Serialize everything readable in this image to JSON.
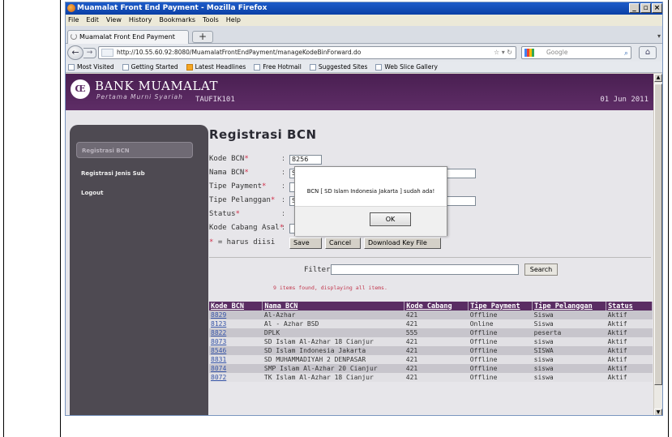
{
  "browser": {
    "window_title": "Muamalat Front End Payment - Mozilla Firefox",
    "menu": [
      "File",
      "Edit",
      "View",
      "History",
      "Bookmarks",
      "Tools",
      "Help"
    ],
    "tab_label": "Muamalat Front End Payment",
    "url": "http://10.55.60.92:8080/MuamalatFrontEndPayment/manageKodeBinForward.do",
    "search_placeholder": "Google",
    "bookmarks": [
      "Most Visited",
      "Getting Started",
      "Latest Headlines",
      "Free Hotmail",
      "Suggested Sites",
      "Web Slice Gallery"
    ]
  },
  "page": {
    "header": {
      "bank_name": "BANK MUAMALAT",
      "tagline": "Pertama Murni Syariah",
      "user": "TAUFIK101",
      "date": "01 Jun 2011"
    },
    "sidebar": [
      "Registrasi BCN",
      "Registrasi Jenis Sub",
      "Logout"
    ],
    "form": {
      "title": "Registrasi BCN",
      "fields": [
        {
          "label": "Kode BCN",
          "value": "8256"
        },
        {
          "label": "Nama BCN",
          "value": "S"
        },
        {
          "label": "Tipe Payment",
          "value": ""
        },
        {
          "label": "Tipe Pelanggan",
          "value": "S"
        },
        {
          "label": "Status",
          "value": ""
        },
        {
          "label": "Kode Cabang Asal",
          "value": ""
        }
      ],
      "required_note": " = harus diisi",
      "buttons": [
        "Save",
        "Cancel",
        "Download Key File"
      ]
    },
    "list": {
      "filter_label": "Filter:",
      "search_label": "Search",
      "found_text": "9 items found, displaying all items.",
      "columns": [
        "Kode BCN",
        "Nama BCN",
        "Kode Cabang",
        "Tipe Payment",
        "Tipe Pelanggan",
        "Status"
      ],
      "rows": [
        [
          "8829",
          "Al-Azhar",
          "421",
          "Offline",
          "Siswa",
          "Aktif"
        ],
        [
          "8123",
          "Al - Azhar BSD",
          "421",
          "Online",
          "Siswa",
          "Aktif"
        ],
        [
          "8822",
          "DPLK",
          "555",
          "Offline",
          "peserta",
          "Aktif"
        ],
        [
          "8073",
          "SD Islam Al-Azhar 18 Cianjur",
          "421",
          "Offline",
          "siswa",
          "Aktif"
        ],
        [
          "8546",
          "SD Islam Indonesia Jakarta",
          "421",
          "Offline",
          "SISWA",
          "Aktif"
        ],
        [
          "8831",
          "SD MUHAMMADIYAH 2 DENPASAR",
          "421",
          "Offline",
          "siswa",
          "Aktif"
        ],
        [
          "8074",
          "SMP Islam Al-Azhar 20 Cianjur",
          "421",
          "Offline",
          "siswa",
          "Aktif"
        ],
        [
          "8072",
          "TK Islam Al-Azhar 18 Cianjur",
          "421",
          "Offline",
          "siswa",
          "Aktif"
        ]
      ]
    },
    "dialog": {
      "message": "BCN [ SD Islam Indonesia Jakarta ] sudah ada!",
      "ok_label": "OK"
    }
  }
}
